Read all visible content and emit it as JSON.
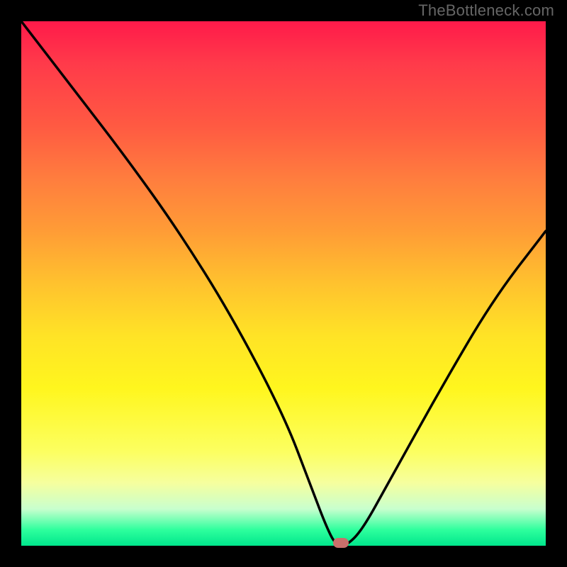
{
  "watermark": "TheBottleneck.com",
  "chart_data": {
    "type": "line",
    "title": "",
    "xlabel": "",
    "ylabel": "",
    "xlim": [
      0,
      100
    ],
    "ylim": [
      0,
      100
    ],
    "series": [
      {
        "name": "curve",
        "x": [
          0,
          10,
          20,
          30,
          40,
          50,
          55,
          58,
          60,
          62,
          65,
          70,
          80,
          90,
          100
        ],
        "y": [
          100,
          87,
          74,
          60,
          44,
          25,
          12,
          4,
          0,
          0,
          3,
          12,
          30,
          47,
          60
        ]
      }
    ],
    "marker": {
      "x": 61,
      "y": 0
    },
    "colors": {
      "background_top": "#ff1a4a",
      "background_bottom": "#00e68c",
      "curve": "#000000",
      "marker": "#c96f6b"
    }
  }
}
